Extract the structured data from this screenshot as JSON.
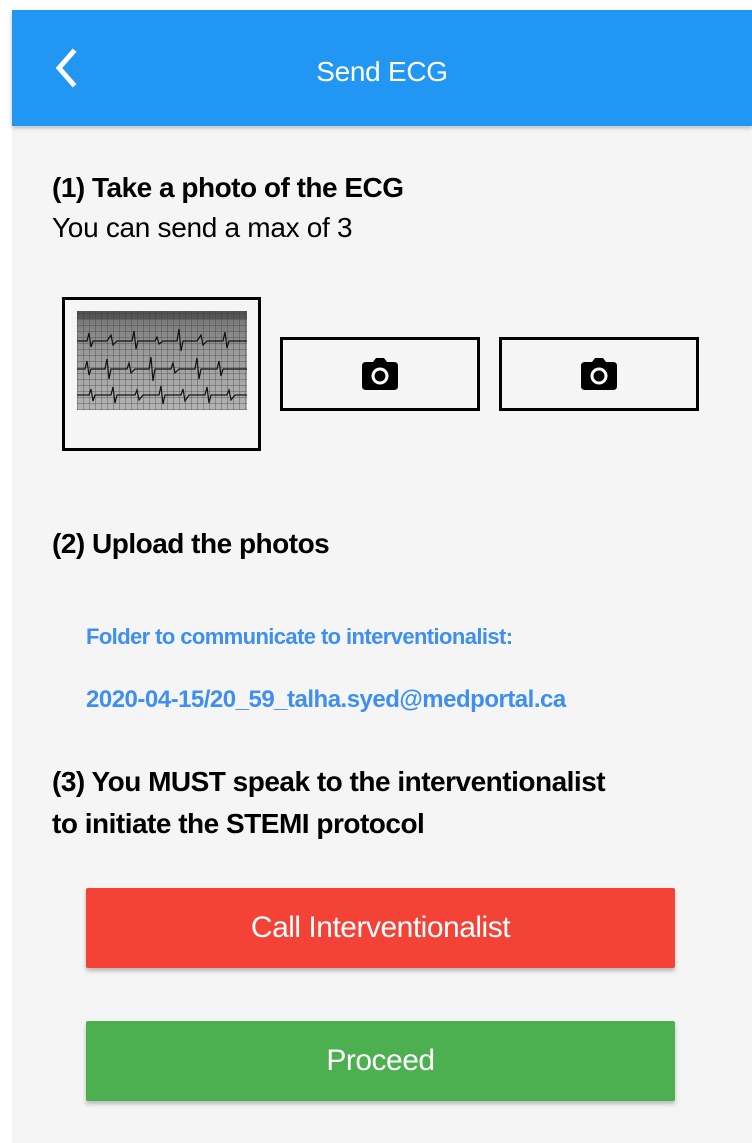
{
  "appbar": {
    "title": "Send ECG",
    "back_icon": "chevron-left-icon",
    "color": "#2196f3"
  },
  "step1": {
    "title": "(1) Take a photo of the ECG",
    "subtitle": "You can send a max of 3",
    "slots": [
      {
        "state": "filled",
        "content": "ecg-photo-thumbnail"
      },
      {
        "state": "empty",
        "icon": "camera-icon"
      },
      {
        "state": "empty",
        "icon": "camera-icon"
      }
    ]
  },
  "step2": {
    "title": "(2) Upload the photos",
    "folder_label": "Folder to communicate to interventionalist:",
    "folder_value": "2020-04-15/20_59_talha.syed@medportal.ca",
    "link_color": "#3e8ff0"
  },
  "step3": {
    "title_line1": "(3) You MUST speak to the interventionalist",
    "title_line2": "to initiate the STEMI protocol"
  },
  "buttons": {
    "call_label": "Call Interventionalist",
    "call_color": "#f44336",
    "proceed_label": "Proceed",
    "proceed_color": "#4caf50"
  }
}
